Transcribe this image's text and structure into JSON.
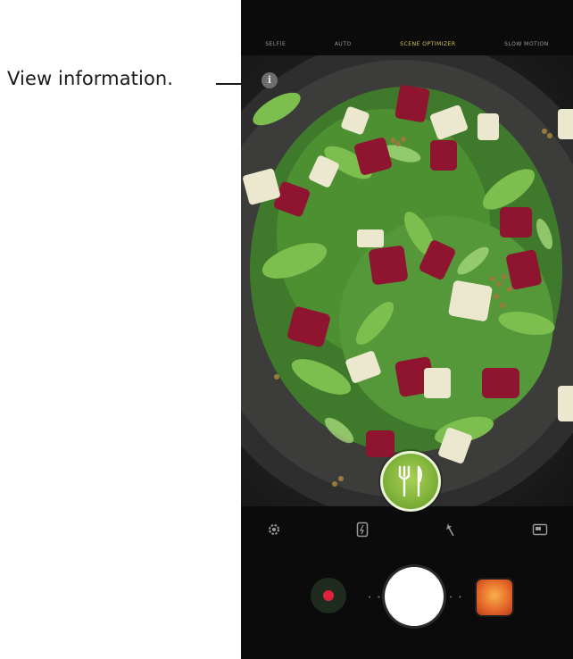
{
  "callout": {
    "text": "View information."
  },
  "camera": {
    "modes": [
      "SELFIE",
      "AUTO",
      "SCENE OPTIMIZER",
      "SLOW MOTION"
    ],
    "active_mode_index": 2,
    "info_glyph": "i",
    "food_mode_icon": "fork-knife-icon",
    "toolbar_icons": [
      "settings-icon",
      "flash-icon",
      "filter-wand-icon",
      "aspect-ratio-icon"
    ],
    "colors": {
      "background": "#0b0b0b",
      "record": "#e0213a",
      "food_mode": "#7fb23a",
      "active_mode": "#d8c44a"
    }
  }
}
